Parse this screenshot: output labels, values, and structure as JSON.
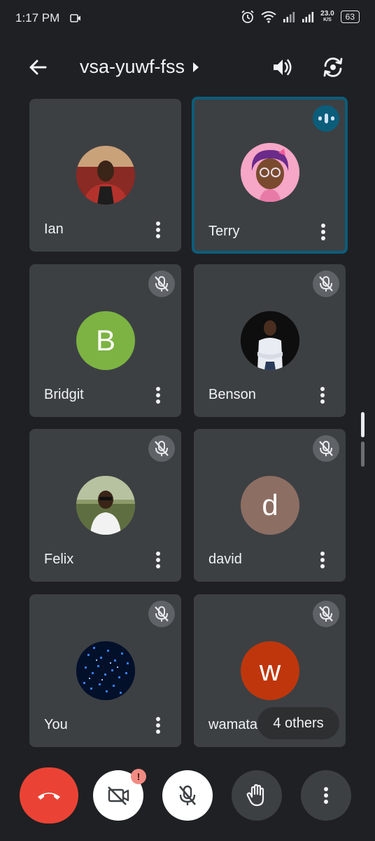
{
  "status_bar": {
    "time": "1:17 PM",
    "net_speed": "23.0",
    "net_unit": "K/S",
    "battery": "63"
  },
  "header": {
    "meeting_code": "vsa-yuwf-fss",
    "icons": [
      "arrow-back-icon",
      "chevron-right-icon",
      "volume-icon",
      "switch-camera-icon"
    ]
  },
  "participants": [
    {
      "name": "Ian",
      "avatar_type": "photo",
      "muted": false,
      "speaking": false
    },
    {
      "name": "Terry",
      "avatar_type": "photo",
      "muted": false,
      "speaking": true
    },
    {
      "name": "Bridgit",
      "avatar_type": "initial",
      "initial": "B",
      "color": "#7cb342",
      "muted": true
    },
    {
      "name": "Benson",
      "avatar_type": "photo",
      "muted": true
    },
    {
      "name": "Felix",
      "avatar_type": "photo",
      "muted": true
    },
    {
      "name": "david",
      "avatar_type": "initial",
      "initial": "d",
      "color": "#8d6e63",
      "muted": true
    },
    {
      "name": "You",
      "avatar_type": "photo",
      "muted": true
    },
    {
      "name": "wamata",
      "avatar_type": "initial",
      "initial": "w",
      "color": "#bf360c",
      "muted": true
    }
  ],
  "others_chip": "4 others",
  "controls": {
    "end_call_color": "#ea4335",
    "camera_alert": "!",
    "icons": [
      "end-call-icon",
      "camera-off-icon",
      "mic-off-icon",
      "raise-hand-icon",
      "more-options-icon"
    ]
  },
  "colors": {
    "background": "#1f2023",
    "tile": "#3c4043",
    "active_border": "#0b5d7a"
  }
}
